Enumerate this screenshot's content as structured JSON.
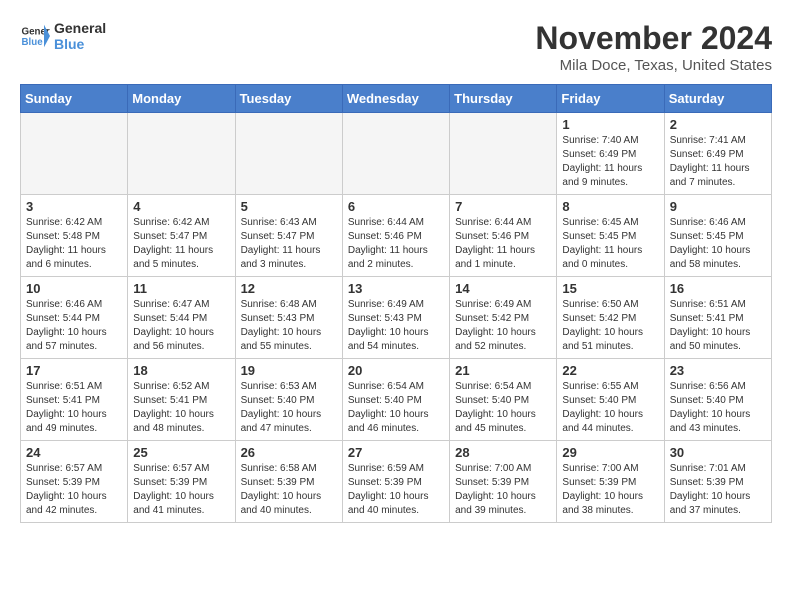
{
  "logo": {
    "line1": "General",
    "line2": "Blue"
  },
  "title": "November 2024",
  "location": "Mila Doce, Texas, United States",
  "weekdays": [
    "Sunday",
    "Monday",
    "Tuesday",
    "Wednesday",
    "Thursday",
    "Friday",
    "Saturday"
  ],
  "weeks": [
    [
      {
        "day": "",
        "info": ""
      },
      {
        "day": "",
        "info": ""
      },
      {
        "day": "",
        "info": ""
      },
      {
        "day": "",
        "info": ""
      },
      {
        "day": "",
        "info": ""
      },
      {
        "day": "1",
        "info": "Sunrise: 7:40 AM\nSunset: 6:49 PM\nDaylight: 11 hours and 9 minutes."
      },
      {
        "day": "2",
        "info": "Sunrise: 7:41 AM\nSunset: 6:49 PM\nDaylight: 11 hours and 7 minutes."
      }
    ],
    [
      {
        "day": "3",
        "info": "Sunrise: 6:42 AM\nSunset: 5:48 PM\nDaylight: 11 hours and 6 minutes."
      },
      {
        "day": "4",
        "info": "Sunrise: 6:42 AM\nSunset: 5:47 PM\nDaylight: 11 hours and 5 minutes."
      },
      {
        "day": "5",
        "info": "Sunrise: 6:43 AM\nSunset: 5:47 PM\nDaylight: 11 hours and 3 minutes."
      },
      {
        "day": "6",
        "info": "Sunrise: 6:44 AM\nSunset: 5:46 PM\nDaylight: 11 hours and 2 minutes."
      },
      {
        "day": "7",
        "info": "Sunrise: 6:44 AM\nSunset: 5:46 PM\nDaylight: 11 hours and 1 minute."
      },
      {
        "day": "8",
        "info": "Sunrise: 6:45 AM\nSunset: 5:45 PM\nDaylight: 11 hours and 0 minutes."
      },
      {
        "day": "9",
        "info": "Sunrise: 6:46 AM\nSunset: 5:45 PM\nDaylight: 10 hours and 58 minutes."
      }
    ],
    [
      {
        "day": "10",
        "info": "Sunrise: 6:46 AM\nSunset: 5:44 PM\nDaylight: 10 hours and 57 minutes."
      },
      {
        "day": "11",
        "info": "Sunrise: 6:47 AM\nSunset: 5:44 PM\nDaylight: 10 hours and 56 minutes."
      },
      {
        "day": "12",
        "info": "Sunrise: 6:48 AM\nSunset: 5:43 PM\nDaylight: 10 hours and 55 minutes."
      },
      {
        "day": "13",
        "info": "Sunrise: 6:49 AM\nSunset: 5:43 PM\nDaylight: 10 hours and 54 minutes."
      },
      {
        "day": "14",
        "info": "Sunrise: 6:49 AM\nSunset: 5:42 PM\nDaylight: 10 hours and 52 minutes."
      },
      {
        "day": "15",
        "info": "Sunrise: 6:50 AM\nSunset: 5:42 PM\nDaylight: 10 hours and 51 minutes."
      },
      {
        "day": "16",
        "info": "Sunrise: 6:51 AM\nSunset: 5:41 PM\nDaylight: 10 hours and 50 minutes."
      }
    ],
    [
      {
        "day": "17",
        "info": "Sunrise: 6:51 AM\nSunset: 5:41 PM\nDaylight: 10 hours and 49 minutes."
      },
      {
        "day": "18",
        "info": "Sunrise: 6:52 AM\nSunset: 5:41 PM\nDaylight: 10 hours and 48 minutes."
      },
      {
        "day": "19",
        "info": "Sunrise: 6:53 AM\nSunset: 5:40 PM\nDaylight: 10 hours and 47 minutes."
      },
      {
        "day": "20",
        "info": "Sunrise: 6:54 AM\nSunset: 5:40 PM\nDaylight: 10 hours and 46 minutes."
      },
      {
        "day": "21",
        "info": "Sunrise: 6:54 AM\nSunset: 5:40 PM\nDaylight: 10 hours and 45 minutes."
      },
      {
        "day": "22",
        "info": "Sunrise: 6:55 AM\nSunset: 5:40 PM\nDaylight: 10 hours and 44 minutes."
      },
      {
        "day": "23",
        "info": "Sunrise: 6:56 AM\nSunset: 5:40 PM\nDaylight: 10 hours and 43 minutes."
      }
    ],
    [
      {
        "day": "24",
        "info": "Sunrise: 6:57 AM\nSunset: 5:39 PM\nDaylight: 10 hours and 42 minutes."
      },
      {
        "day": "25",
        "info": "Sunrise: 6:57 AM\nSunset: 5:39 PM\nDaylight: 10 hours and 41 minutes."
      },
      {
        "day": "26",
        "info": "Sunrise: 6:58 AM\nSunset: 5:39 PM\nDaylight: 10 hours and 40 minutes."
      },
      {
        "day": "27",
        "info": "Sunrise: 6:59 AM\nSunset: 5:39 PM\nDaylight: 10 hours and 40 minutes."
      },
      {
        "day": "28",
        "info": "Sunrise: 7:00 AM\nSunset: 5:39 PM\nDaylight: 10 hours and 39 minutes."
      },
      {
        "day": "29",
        "info": "Sunrise: 7:00 AM\nSunset: 5:39 PM\nDaylight: 10 hours and 38 minutes."
      },
      {
        "day": "30",
        "info": "Sunrise: 7:01 AM\nSunset: 5:39 PM\nDaylight: 10 hours and 37 minutes."
      }
    ]
  ]
}
